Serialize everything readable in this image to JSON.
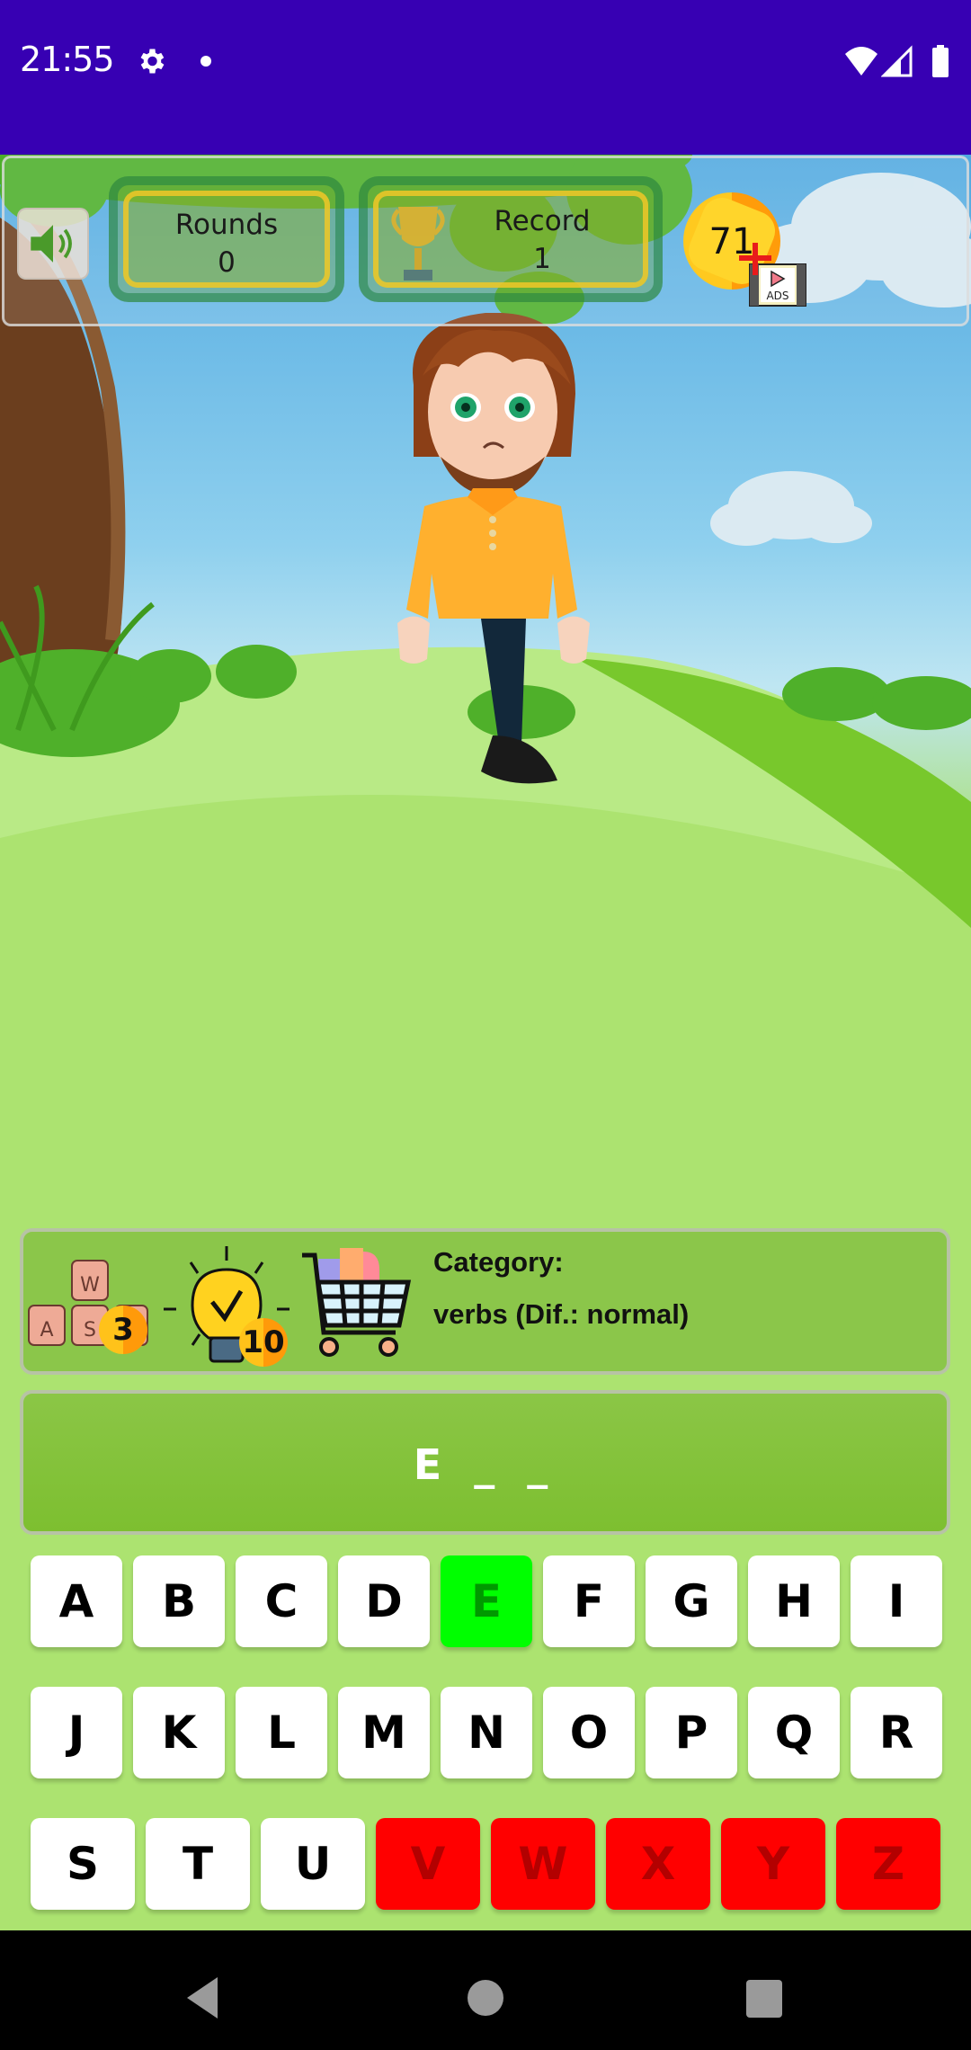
{
  "status_bar": {
    "time": "21:55",
    "icons": [
      "gear-icon",
      "notification-dot-icon",
      "wifi-icon",
      "signal-icon",
      "battery-icon"
    ]
  },
  "hud": {
    "sound_icon": "speaker-on-icon",
    "rounds_label": "Rounds",
    "rounds_value": "0",
    "record_label": "Record",
    "record_value": "1",
    "coins": "71",
    "ads_label": "ADS"
  },
  "info": {
    "reveal_letter_cost": "3",
    "hint_cost": "10",
    "shop_icon": "shopping-cart-icon",
    "category_label": "Category:",
    "category_value": "verbs (Dif.: normal)"
  },
  "word": {
    "display": "E _ _"
  },
  "keyboard": {
    "rows": [
      [
        {
          "letter": "A",
          "state": "unused"
        },
        {
          "letter": "B",
          "state": "unused"
        },
        {
          "letter": "C",
          "state": "unused"
        },
        {
          "letter": "D",
          "state": "unused"
        },
        {
          "letter": "E",
          "state": "correct"
        },
        {
          "letter": "F",
          "state": "unused"
        },
        {
          "letter": "G",
          "state": "unused"
        },
        {
          "letter": "H",
          "state": "unused"
        },
        {
          "letter": "I",
          "state": "unused"
        }
      ],
      [
        {
          "letter": "J",
          "state": "unused"
        },
        {
          "letter": "K",
          "state": "unused"
        },
        {
          "letter": "L",
          "state": "unused"
        },
        {
          "letter": "M",
          "state": "unused"
        },
        {
          "letter": "N",
          "state": "unused"
        },
        {
          "letter": "O",
          "state": "unused"
        },
        {
          "letter": "P",
          "state": "unused"
        },
        {
          "letter": "Q",
          "state": "unused"
        },
        {
          "letter": "R",
          "state": "unused"
        }
      ],
      [
        {
          "letter": "S",
          "state": "unused"
        },
        {
          "letter": "T",
          "state": "unused"
        },
        {
          "letter": "U",
          "state": "unused"
        },
        {
          "letter": "V",
          "state": "wrong"
        },
        {
          "letter": "W",
          "state": "wrong"
        },
        {
          "letter": "X",
          "state": "wrong"
        },
        {
          "letter": "Y",
          "state": "wrong"
        },
        {
          "letter": "Z",
          "state": "wrong"
        }
      ]
    ]
  },
  "colors": {
    "status_bar": "#3700b3",
    "correct_key": "#00ff00",
    "wrong_key": "#ff0000",
    "panel_green": "#8bc64a"
  }
}
